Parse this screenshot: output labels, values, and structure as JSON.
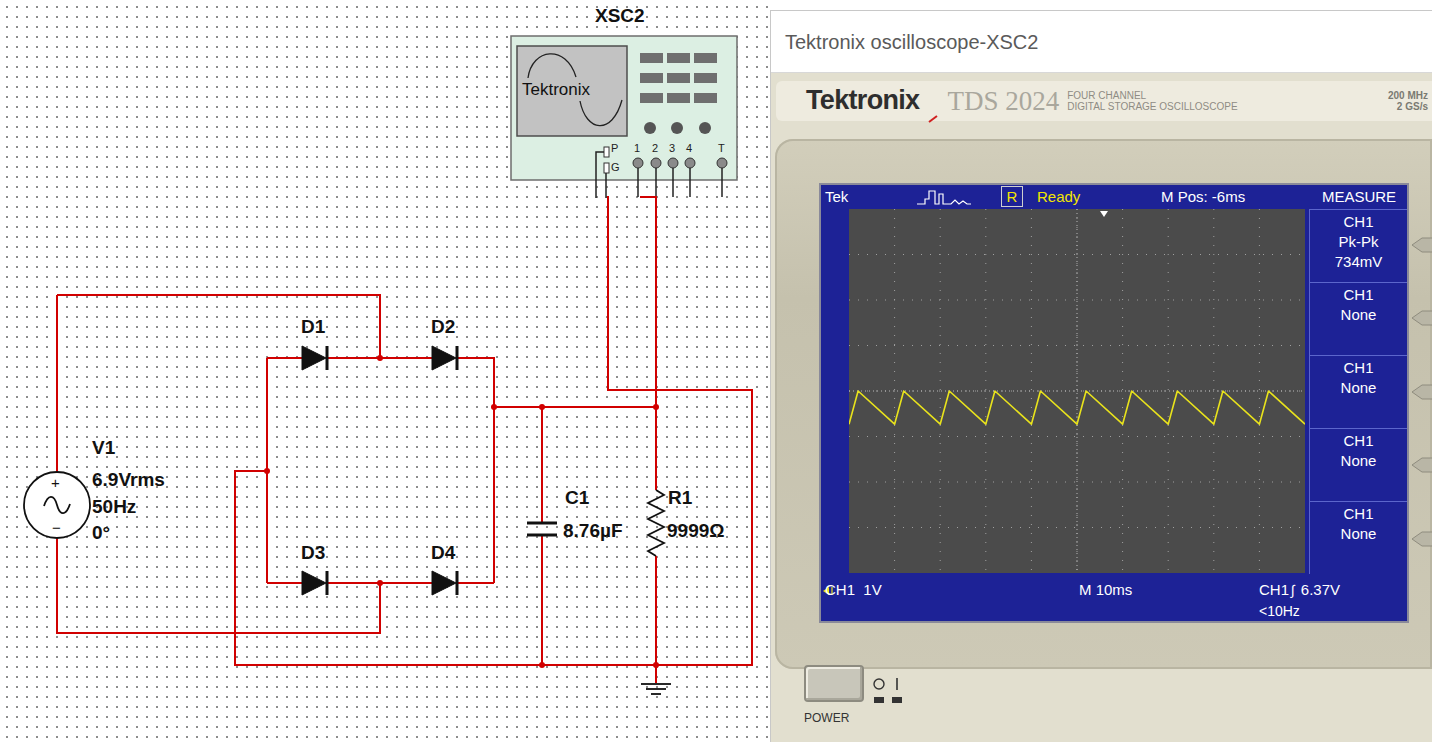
{
  "schematic": {
    "scope": {
      "name": "XSC2",
      "brand": "Tektronix",
      "pins": [
        "P",
        "G",
        "1",
        "2",
        "3",
        "4",
        "T"
      ]
    },
    "source": {
      "name": "V1",
      "voltage": "6.9Vrms",
      "frequency": "50Hz",
      "phase": "0°",
      "plus": "+",
      "minus": "−"
    },
    "diodes": [
      {
        "name": "D1"
      },
      {
        "name": "D2"
      },
      {
        "name": "D3"
      },
      {
        "name": "D4"
      }
    ],
    "capacitor": {
      "name": "C1",
      "value": "8.76µF"
    },
    "resistor": {
      "name": "R1",
      "value": "9999Ω"
    }
  },
  "window": {
    "title": "Tektronix oscilloscope-XSC2"
  },
  "oscilloscope": {
    "brand": "Tektronix",
    "model": "TDS 2024",
    "description": [
      "FOUR CHANNEL",
      "DIGITAL STORAGE OSCILLOSCOPE"
    ],
    "specs": [
      "200 MHz",
      "2 GS/s"
    ],
    "screen": {
      "tek": "Tek",
      "run_state": "R",
      "status": "Ready",
      "position": "M Pos: -6ms",
      "channel_scale": "CH1  1V",
      "timebase": "M 10ms",
      "trigger_source": "CH1",
      "trigger_slope": "∫",
      "trigger_level": "6.37V",
      "frequency": "<10Hz"
    },
    "measure": {
      "title": "MEASURE",
      "items": [
        {
          "source": "CH1",
          "type": "Pk-Pk",
          "value": "734mV"
        },
        {
          "source": "CH1",
          "type": "None"
        },
        {
          "source": "CH1",
          "type": "None"
        },
        {
          "source": "CH1",
          "type": "None"
        },
        {
          "source": "CH1",
          "type": "None"
        }
      ]
    },
    "waveform": {
      "t_ms": [
        0,
        2,
        10,
        12,
        20,
        22,
        30,
        32,
        40,
        42,
        50,
        52,
        60,
        62,
        70,
        72,
        80,
        82,
        90,
        92,
        100
      ],
      "volts": [
        7.62,
        8.35,
        7.62,
        8.35,
        7.62,
        8.35,
        7.62,
        8.35,
        7.62,
        8.35,
        7.62,
        8.35,
        7.62,
        8.35,
        7.62,
        8.35,
        7.62,
        8.35,
        7.62,
        8.35,
        7.62
      ]
    },
    "power": "POWER"
  }
}
